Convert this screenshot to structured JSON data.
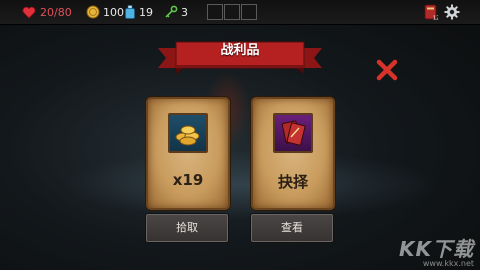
{
  "hud": {
    "hp": "20/80",
    "gold": "100",
    "potions": "19",
    "keys": "3",
    "deck_count": "12",
    "hp_color": "#e0505a"
  },
  "reward": {
    "title": "战利品",
    "items": [
      {
        "icon": "gold-coins-icon",
        "label": "x19",
        "button": "拾取"
      },
      {
        "icon": "card-icon",
        "label": "抉择",
        "button": "查看"
      }
    ]
  },
  "watermark": {
    "main": "KK下载",
    "sub": "www.kkx.net"
  }
}
